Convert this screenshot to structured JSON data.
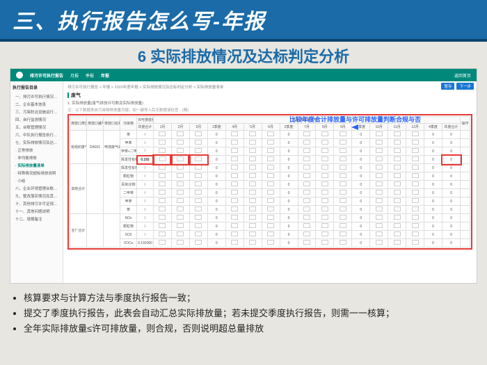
{
  "title": "三、执行报告怎么写-年报",
  "subtitle": "6 实际排放情况及达标判定分析",
  "app": {
    "brand": "排污许可执行报告",
    "nav": [
      "月报",
      "季报",
      "年报"
    ],
    "nav_right": "返回首页",
    "sidebar_title": "执行报告目录",
    "sidebar": [
      "一、排污许可执行情况汇总表",
      "二、企业基本信息",
      "三、污染防治设施运行情况",
      "四、自行监测情况",
      "五、台账管理情况",
      "六、中队执行报告执行监督信息",
      "七、实际排放情况及达标判定分析",
      "· 正常排放",
      "· 非均衡排放",
      "· 实际排放量清单",
      "· 特殊情况超标排放说明",
      "· 小结",
      "八、企业环境管理台账记录执行情况",
      "九、整改落实情况及其他需要说明的…",
      "十、其他排污许可证规定的内容执行…",
      "十一、其他问题说明",
      "十二、填报备注"
    ],
    "breadcrumb": "排污许可执行报告 > 年报 > 2020年度年报 > 实际排放情况及达标判定分析 > 实际排放量清单",
    "buttons": {
      "tmp": "暂存",
      "next": "下一步"
    },
    "section": "废气",
    "sub": "1. 实际排放量(废气排放许可数及实际排放量)",
    "subnote": "注：以下数据来自污染物排放量月报，如一键导入后无数据请检查…(略)",
    "annotation": "比较年度合计排放量与许可排放量判断合规与否",
    "headers": {
      "c1": "排放口类型",
      "c2": "排放口编号",
      "c3": "排放口名称",
      "c4": "污染物",
      "permit": "许可排放量（吨）",
      "permit_sub": "年度合计",
      "actual": "实际排放量（吨）",
      "months": [
        "1月",
        "2月",
        "3月",
        "1季度",
        "4月",
        "5月",
        "6月",
        "2季度",
        "7月",
        "8月",
        "9月",
        "3季度",
        "10月",
        "11月",
        "12月",
        "4季度",
        "年度合计"
      ],
      "op": "操作"
    },
    "row_groups": [
      {
        "type": "有组织废气主要排放口",
        "code": "DA001",
        "name": "喷漆废气处理设施",
        "rows": [
          {
            "p": "苯",
            "v": "/"
          },
          {
            "p": "甲苯",
            "v": "/"
          },
          {
            "p": "甲苯+二甲苯",
            "v": "/"
          },
          {
            "p": "挥发性有机物",
            "v": "0.192",
            "hl": true
          }
        ]
      },
      {
        "type": "其他合计",
        "rows": [
          {
            "p": "挥发性有机物",
            "v": "/"
          },
          {
            "p": "颗粒物",
            "v": "/"
          },
          {
            "p": "氮氧化物",
            "v": "/"
          },
          {
            "p": "二甲苯",
            "v": "/"
          },
          {
            "p": "甲苯",
            "v": "/"
          },
          {
            "p": "苯",
            "v": "/"
          }
        ]
      },
      {
        "type": "全厂合计",
        "rows": [
          {
            "p": "NOx",
            "v": "/"
          },
          {
            "p": "颗粒物",
            "v": "/"
          },
          {
            "p": "SO2",
            "v": "/"
          },
          {
            "p": "VOCs",
            "v": "0.192000"
          }
        ]
      }
    ]
  },
  "bullets": [
    "核算要求与计算方法与季度执行报告一致；",
    "提交了季度执行报告，此表会自动汇总实际排放量；若未提交季度执行报告，则需一一核算；",
    "全年实际排放量≤许可排放量，则合规，否则说明超总量排放"
  ]
}
